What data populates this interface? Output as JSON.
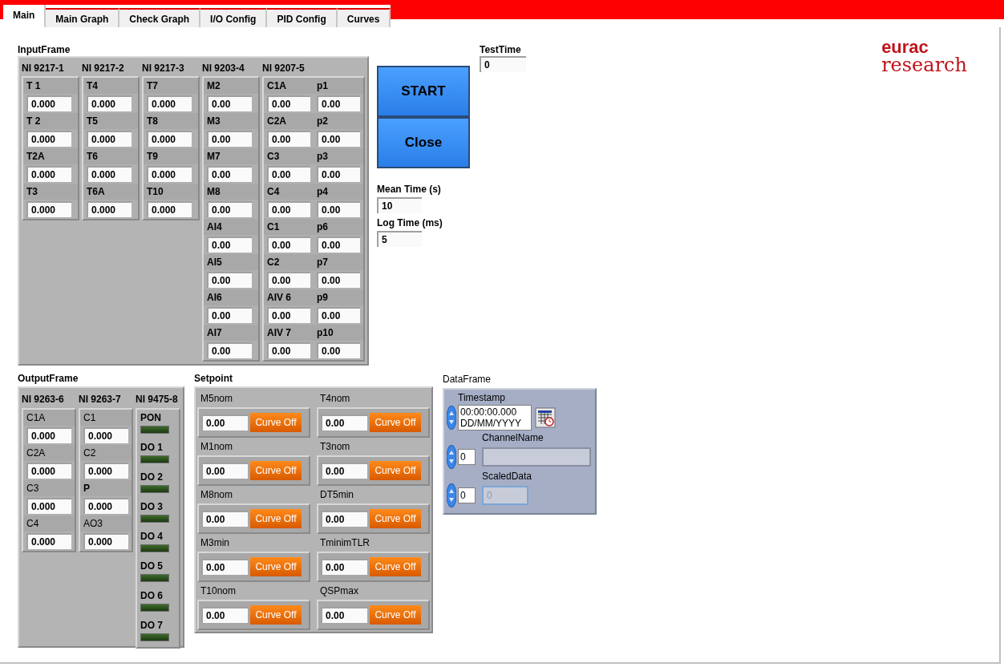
{
  "tabs": [
    {
      "label": "Main",
      "selected": true
    },
    {
      "label": "Main Graph",
      "selected": false
    },
    {
      "label": "Check Graph",
      "selected": false
    },
    {
      "label": "I/O Config",
      "selected": false
    },
    {
      "label": "PID Config",
      "selected": false
    },
    {
      "label": "Curves",
      "selected": false
    }
  ],
  "input_frame": {
    "title": "InputFrame",
    "modules": [
      {
        "name": "NI 9217-1",
        "kind": "single",
        "channels": [
          {
            "label": "T 1",
            "value": "0.000"
          },
          {
            "label": "T 2",
            "value": "0.000"
          },
          {
            "label": "T2A",
            "value": "0.000"
          },
          {
            "label": "T3",
            "value": "0.000"
          }
        ]
      },
      {
        "name": "NI 9217-2",
        "kind": "single",
        "channels": [
          {
            "label": "T4",
            "value": "0.000"
          },
          {
            "label": "T5",
            "value": "0.000"
          },
          {
            "label": "T6",
            "value": "0.000"
          },
          {
            "label": "T6A",
            "value": "0.000"
          }
        ]
      },
      {
        "name": "NI 9217-3",
        "kind": "single",
        "channels": [
          {
            "label": "T7",
            "value": "0.000"
          },
          {
            "label": "T8",
            "value": "0.000"
          },
          {
            "label": "T9",
            "value": "0.000"
          },
          {
            "label": "T10",
            "value": "0.000"
          }
        ]
      },
      {
        "name": "NI 9203-4",
        "kind": "single",
        "channels": [
          {
            "label": "M2",
            "value": "0.00"
          },
          {
            "label": "M3",
            "value": "0.00"
          },
          {
            "label": "M7",
            "value": "0.00"
          },
          {
            "label": "M8",
            "value": "0.00"
          },
          {
            "label": "AI4",
            "value": "0.00"
          },
          {
            "label": "AI5",
            "value": "0.00"
          },
          {
            "label": "AI6",
            "value": "0.00"
          },
          {
            "label": "AI7",
            "value": "0.00"
          }
        ]
      },
      {
        "name": "NI 9207-5",
        "kind": "double",
        "channels": [
          {
            "label": "C1A",
            "value": "0.00"
          },
          {
            "label": "p1",
            "value": "0.00"
          },
          {
            "label": "C2A",
            "value": "0.00"
          },
          {
            "label": "p2",
            "value": "0.00"
          },
          {
            "label": "C3",
            "value": "0.00"
          },
          {
            "label": "p3",
            "value": "0.00"
          },
          {
            "label": "C4",
            "value": "0.00"
          },
          {
            "label": "p4",
            "value": "0.00"
          },
          {
            "label": "C1",
            "value": "0.00"
          },
          {
            "label": "p6",
            "value": "0.00"
          },
          {
            "label": "C2",
            "value": "0.00"
          },
          {
            "label": "p7",
            "value": "0.00"
          },
          {
            "label": "AIV 6",
            "value": "0.00"
          },
          {
            "label": "p9",
            "value": "0.00"
          },
          {
            "label": "AIV 7",
            "value": "0.00"
          },
          {
            "label": "p10",
            "value": "0.00"
          }
        ]
      }
    ]
  },
  "buttons": [
    {
      "label": "START"
    },
    {
      "label": "Close"
    }
  ],
  "mean_time": {
    "label": "Mean Time (s)",
    "value": "10"
  },
  "log_time": {
    "label": "Log Time (ms)",
    "value": "5"
  },
  "test_time": {
    "label": "TestTime",
    "value": "0"
  },
  "logo": {
    "line_1": "eurac",
    "line_2": "research"
  },
  "output_frame": {
    "title": "OutputFrame",
    "modules": [
      {
        "name": "NI 9263-6",
        "kind": "analog",
        "channels": [
          {
            "label": "C1A",
            "bold": false,
            "value": "0.000"
          },
          {
            "label": "C2A",
            "bold": false,
            "value": "0.000"
          },
          {
            "label": "C3",
            "bold": false,
            "value": "0.000"
          },
          {
            "label": "C4",
            "bold": false,
            "value": "0.000"
          }
        ]
      },
      {
        "name": "NI 9263-7",
        "kind": "analog",
        "channels": [
          {
            "label": "C1",
            "bold": false,
            "value": "0.000"
          },
          {
            "label": "C2",
            "bold": false,
            "value": "0.000"
          },
          {
            "label": "P",
            "bold": true,
            "value": "0.000"
          },
          {
            "label": "AO3",
            "bold": false,
            "value": "0.000"
          }
        ]
      },
      {
        "name": "NI 9475-8",
        "kind": "digital",
        "channels": [
          {
            "label": "PON",
            "on": false
          },
          {
            "label": "DO 1",
            "on": false
          },
          {
            "label": "DO 2",
            "on": false
          },
          {
            "label": "DO 3",
            "on": false
          },
          {
            "label": "DO 4",
            "on": false
          },
          {
            "label": "DO 5",
            "on": false
          },
          {
            "label": "DO 6",
            "on": false
          },
          {
            "label": "DO 7",
            "on": false
          }
        ]
      }
    ]
  },
  "setpoint": {
    "title": "Setpoint",
    "items": [
      {
        "label": "M5nom",
        "value": "0.00",
        "button": "Curve Off"
      },
      {
        "label": "T4nom",
        "value": "0.00",
        "button": "Curve Off"
      },
      {
        "label": "M1nom",
        "value": "0.00",
        "button": "Curve Off"
      },
      {
        "label": "T3nom",
        "value": "0.00",
        "button": "Curve Off"
      },
      {
        "label": "M8nom",
        "value": "0.00",
        "button": "Curve Off"
      },
      {
        "label": "DT5min",
        "value": "0.00",
        "button": "Curve Off"
      },
      {
        "label": "M3min",
        "value": "0.00",
        "button": "Curve Off"
      },
      {
        "label": "TminimTLR",
        "value": "0.00",
        "button": "Curve Off"
      },
      {
        "label": "T10nom",
        "value": "0.00",
        "button": "Curve Off"
      },
      {
        "label": "QSPmax",
        "value": "0.00",
        "button": "Curve Off"
      }
    ]
  },
  "data_frame": {
    "title": "DataFrame",
    "timestamp_label": "Timestamp",
    "time": "00:00:00.000",
    "date": "DD/MM/YYYY",
    "channel_index": "0",
    "channel_label": "ChannelName",
    "data_index": "0",
    "data_label": "ScaledData",
    "data_value": "0",
    "data_disabled": true
  }
}
